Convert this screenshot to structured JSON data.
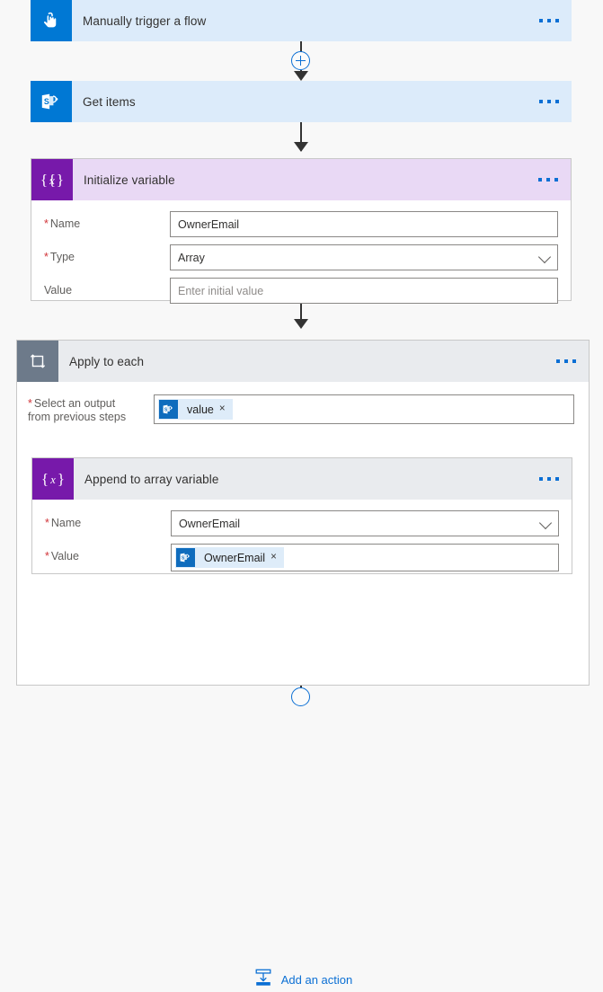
{
  "flow": {
    "steps": [
      {
        "id": "trigger",
        "title": "Manually trigger a flow",
        "icon": "tap-hand-icon",
        "theme": "blue"
      },
      {
        "id": "get-items",
        "title": "Get items",
        "icon": "sharepoint-icon",
        "theme": "blue"
      },
      {
        "id": "initialize-variable",
        "title": "Initialize variable",
        "icon": "variable-braces-icon",
        "theme": "purple",
        "fields": [
          {
            "label": "Name",
            "required": true,
            "value": "OwnerEmail",
            "control": "text"
          },
          {
            "label": "Type",
            "required": true,
            "value": "Array",
            "control": "dropdown"
          },
          {
            "label": "Value",
            "required": false,
            "placeholder": "Enter initial value",
            "control": "text"
          }
        ]
      },
      {
        "id": "apply-to-each",
        "title": "Apply to each",
        "icon": "loop-icon",
        "theme": "gray",
        "select_output": {
          "label_line1": "Select an output",
          "label_line2": "from previous steps",
          "required": true,
          "token": {
            "text": "value",
            "icon": "sharepoint-icon",
            "remove": "×"
          }
        },
        "child": {
          "id": "append-to-array-variable",
          "title": "Append to array variable",
          "icon": "variable-braces-icon",
          "theme": "purple",
          "fields": [
            {
              "label": "Name",
              "required": true,
              "value": "OwnerEmail",
              "control": "dropdown"
            },
            {
              "label": "Value",
              "required": true,
              "control": "token",
              "token": {
                "text": "OwnerEmail",
                "icon": "sharepoint-icon",
                "remove": "×"
              }
            }
          ]
        },
        "add_action": {
          "label": "Add an action",
          "icon": "add-action-icon"
        }
      }
    ],
    "connector_plus_label": "+",
    "required_marker": "*"
  },
  "colors": {
    "trigger_header": "#dcebfa",
    "trigger_icon": "#0078d4",
    "variable_header": "#e9d9f5",
    "variable_icon": "#7719aa",
    "loop_header": "#e9ebee",
    "loop_icon": "#6d7a8a",
    "accent_link": "#0b6fd4",
    "required_asterisk": "#d13438",
    "token_chip": "#deecf9",
    "canvas": "#f8f8f8"
  }
}
